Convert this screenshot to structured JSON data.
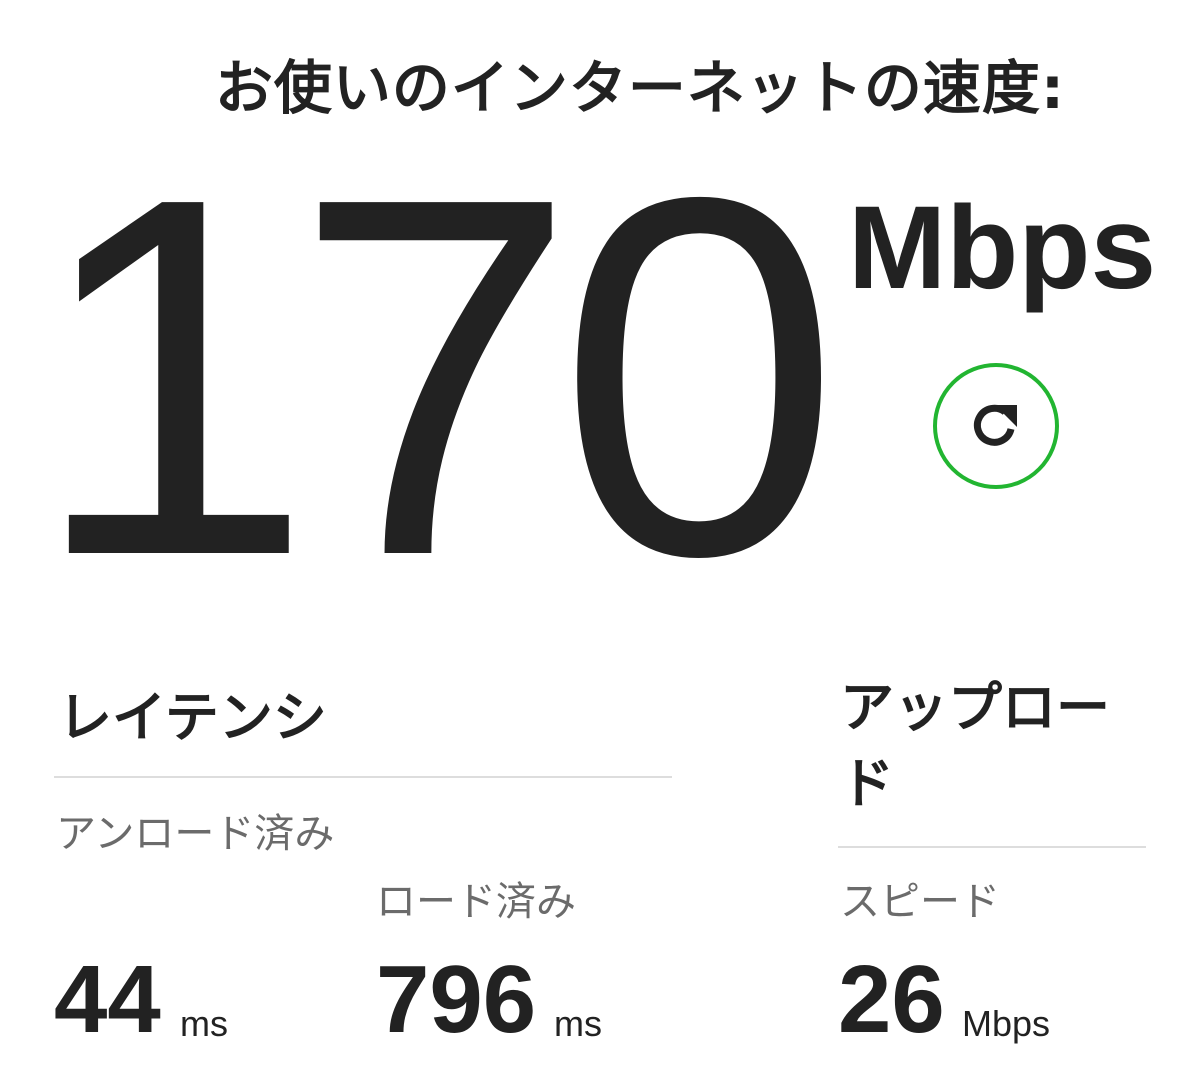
{
  "header": {
    "title": "お使いのインターネットの速度:"
  },
  "speed": {
    "value": "170",
    "unit": "Mbps"
  },
  "refresh": {
    "icon": "refresh-icon",
    "accent_color": "#22b531"
  },
  "latency": {
    "title": "レイテンシ",
    "unloaded": {
      "label": "アンロード済み",
      "value": "44",
      "unit": "ms"
    },
    "loaded": {
      "label": "ロード済み",
      "value": "796",
      "unit": "ms"
    }
  },
  "upload": {
    "title": "アップロード",
    "speed": {
      "label": "スピード",
      "value": "26",
      "unit": "Mbps"
    }
  }
}
